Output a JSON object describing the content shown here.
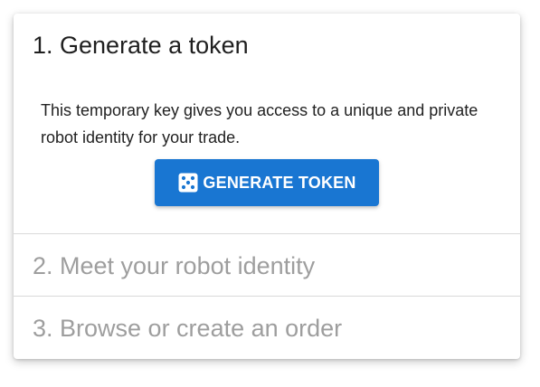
{
  "steps": [
    {
      "title": "1. Generate a token",
      "description": "This temporary key gives you access to a unique and private robot identity for your trade.",
      "button_label": "GENERATE TOKEN",
      "button_icon": "dice-icon",
      "active": true
    },
    {
      "title": "2. Meet your robot identity",
      "active": false
    },
    {
      "title": "3. Browse or create an order",
      "active": false
    }
  ],
  "colors": {
    "primary": "#1976d2",
    "active_text": "#1f1f1f",
    "inactive_text": "#9e9e9e",
    "divider": "#d9d9d9"
  }
}
